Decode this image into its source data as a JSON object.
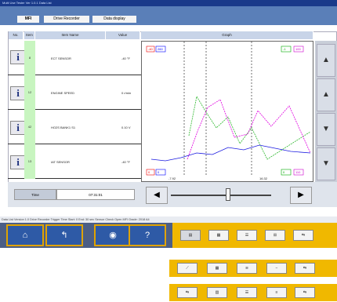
{
  "window": {
    "title": "Multi Use Tester  Ver 1.0.1  Data List"
  },
  "tabs": [
    {
      "label": "MFI"
    },
    {
      "label": "Drive Recorder"
    },
    {
      "label": "Data display"
    }
  ],
  "table": {
    "headers": [
      "No.",
      "Item No.",
      "Item Name",
      "Value",
      "Graph"
    ],
    "rows": [
      {
        "num": "8",
        "name": "ECT SENSOR",
        "value": "-40 °F"
      },
      {
        "num": "12",
        "name": "ENGINE SPEED",
        "value": "0 r/min"
      },
      {
        "num": "42",
        "name": "HO2S BANK1 S1",
        "value": "0.10 V"
      },
      {
        "num": "13",
        "name": "IAT SENSOR",
        "value": "-40 °F"
      }
    ]
  },
  "graph": {
    "top_left_labels": [
      "-40",
      "260"
    ],
    "top_right_labels": [
      "-1",
      "100"
    ],
    "bottom_left_labels": [
      "0",
      "0"
    ],
    "bottom_right_labels": [
      "0",
      "110"
    ],
    "bottom_time_labels": [
      "-7.92",
      "16.32"
    ]
  },
  "time": {
    "label": "Time",
    "value": "07:31:01"
  },
  "status_text": "Data List Version 1.0  Drive Recorder Trigger Time  Start: 0  End: 30 sec  Sensor Check  Open MFI  Grade: 2018 A4",
  "colors": {
    "green": "#2db82d",
    "magenta": "#e000e0",
    "blue": "#1a1ae0",
    "accent": "#f0b800"
  }
}
